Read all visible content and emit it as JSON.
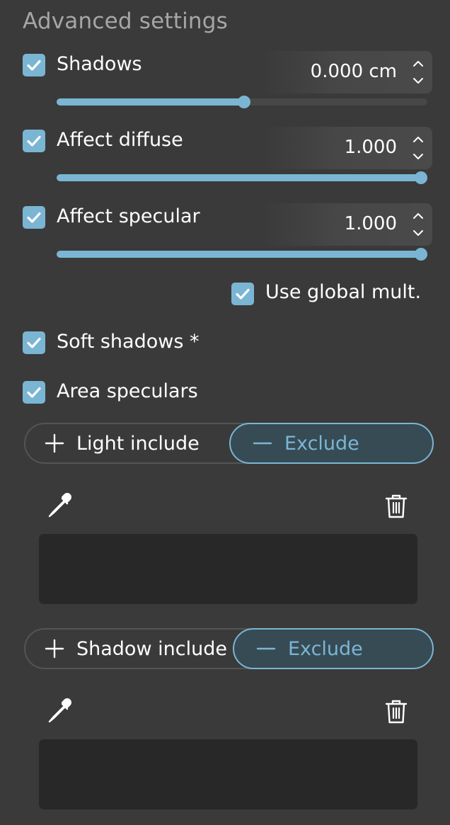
{
  "section": {
    "title": "Advanced settings"
  },
  "shadows": {
    "label": "Shadows",
    "checked": true,
    "value": "0.000 cm",
    "slider": 0.505
  },
  "affect_diffuse": {
    "label": "Affect diffuse",
    "checked": true,
    "value": "1.000",
    "slider": 1.0
  },
  "affect_specular": {
    "label": "Affect specular",
    "checked": true,
    "value": "1.000",
    "slider": 1.0
  },
  "use_global_mult": {
    "label": "Use global mult.",
    "checked": true
  },
  "soft_shadows": {
    "label": "Soft shadows *",
    "checked": true
  },
  "area_speculars": {
    "label": "Area speculars",
    "checked": true
  },
  "light_toggle": {
    "include_label": "Light include",
    "exclude_label": "Exclude",
    "selected": "Exclude"
  },
  "shadow_toggle": {
    "include_label": "Shadow include",
    "exclude_label": "Exclude",
    "selected": "Exclude"
  },
  "icons": {
    "picker": "eyedropper-icon",
    "delete": "trash-icon",
    "check": "checkmark-icon",
    "spinner": "up-down-arrows-icon",
    "include": "plus-icon",
    "exclude": "minus-icon"
  },
  "colors": {
    "background": "#3a3a3a",
    "accent": "#7ab6d3",
    "title": "#a6a6a6",
    "listbox": "#282828",
    "selected_segment": "#374b55"
  }
}
